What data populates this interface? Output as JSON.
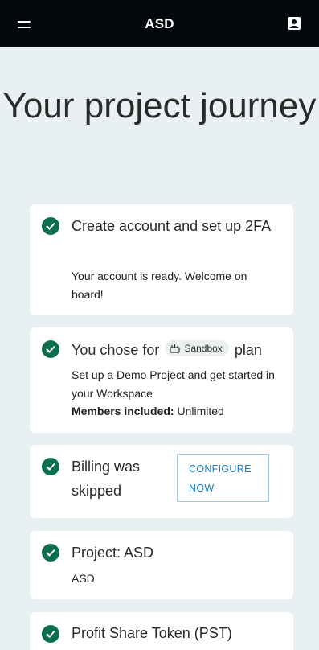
{
  "header": {
    "title": "ASD"
  },
  "page": {
    "title": "Your project journey"
  },
  "steps": [
    {
      "title": "Create account and set up 2FA",
      "description": "Your account is ready. Welcome on board!"
    },
    {
      "title_prefix": "You chose for",
      "plan_badge": "Sandbox",
      "title_suffix": "plan",
      "description": "Set up a Demo Project and get started in your Workspace",
      "members_label": "Members included:",
      "members_value": "Unlimited"
    },
    {
      "title": "Billing was skipped",
      "action_label": "CONFIGURE NOW"
    },
    {
      "title": "Project: ASD",
      "description": "ASD"
    },
    {
      "title": "Profit Share Token (PST)"
    }
  ],
  "colors": {
    "topbar": "#04090b",
    "background": "#e8f0f2",
    "check": "#0b6e4f",
    "link": "#1f7fbf"
  }
}
